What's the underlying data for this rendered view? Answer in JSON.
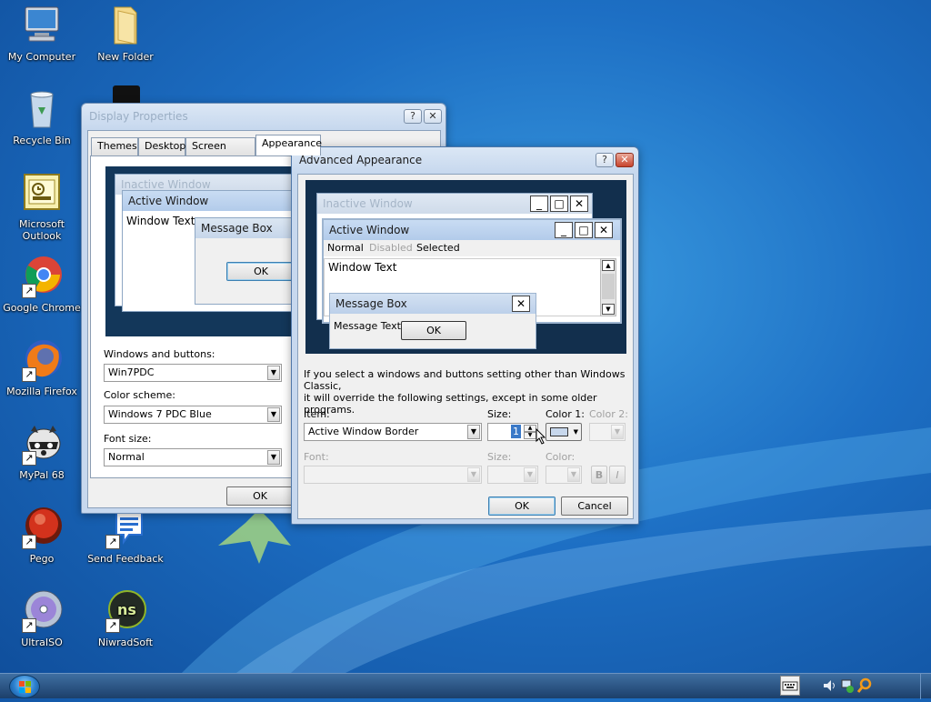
{
  "desktop": {
    "icons": [
      {
        "label": "My Computer",
        "icon": "computer-icon"
      },
      {
        "label": "New Folder",
        "icon": "folder-icon"
      },
      {
        "label": "Recycle Bin",
        "icon": "recycle-bin-icon"
      },
      {
        "label": "Microsoft Outlook",
        "icon": "outlook-icon"
      },
      {
        "label": "Google Chrome",
        "icon": "chrome-icon"
      },
      {
        "label": "Mozilla Firefox",
        "icon": "firefox-icon"
      },
      {
        "label": "MyPal 68",
        "icon": "mypal-icon"
      },
      {
        "label": "Pego",
        "icon": "pego-icon"
      },
      {
        "label": "Send Feedback",
        "icon": "feedback-icon"
      },
      {
        "label": "UltraISO",
        "icon": "ultraiso-icon"
      },
      {
        "label": "NiwradSoft",
        "icon": "niwradsoft-icon"
      }
    ]
  },
  "display_properties": {
    "title": "Display Properties",
    "help_btn": "?",
    "close_btn": "✕",
    "tabs": [
      "Themes",
      "Desktop",
      "Screen Saver",
      "Appearance"
    ],
    "preview": {
      "inactive_window": "Inactive Window",
      "active_window": "Active Window",
      "window_text": "Window Text",
      "message_box": "Message Box",
      "ok": "OK"
    },
    "windows_buttons_label": "Windows and buttons:",
    "windows_buttons_value": "Win7PDC",
    "color_scheme_label": "Color scheme:",
    "color_scheme_value": "Windows 7 PDC Blue",
    "font_size_label": "Font size:",
    "font_size_value": "Normal",
    "ok_button": "OK"
  },
  "advanced_appearance": {
    "title": "Advanced Appearance",
    "help_btn": "?",
    "close_btn": "✕",
    "preview": {
      "inactive_window": "Inactive Window",
      "active_window": "Active Window",
      "menu_normal": "Normal",
      "menu_disabled": "Disabled",
      "menu_selected": "Selected",
      "window_text": "Window Text",
      "message_box": "Message Box",
      "message_text": "Message Text",
      "ok": "OK",
      "minimize": "_",
      "maximize": "□",
      "close": "✕"
    },
    "info_text_line1": "If you select a windows and buttons setting other than Windows Classic,",
    "info_text_line2": "it will override the following settings, except in some older programs.",
    "item_label": "Item:",
    "item_value": "Active Window Border",
    "size_label": "Size:",
    "size_value": "1",
    "color1_label": "Color 1:",
    "color2_label": "Color 2:",
    "font_label": "Font:",
    "font_size_label": "Size:",
    "font_color_label": "Color:",
    "bold_btn": "B",
    "italic_btn": "I",
    "ok_button": "OK",
    "cancel_button": "Cancel"
  }
}
